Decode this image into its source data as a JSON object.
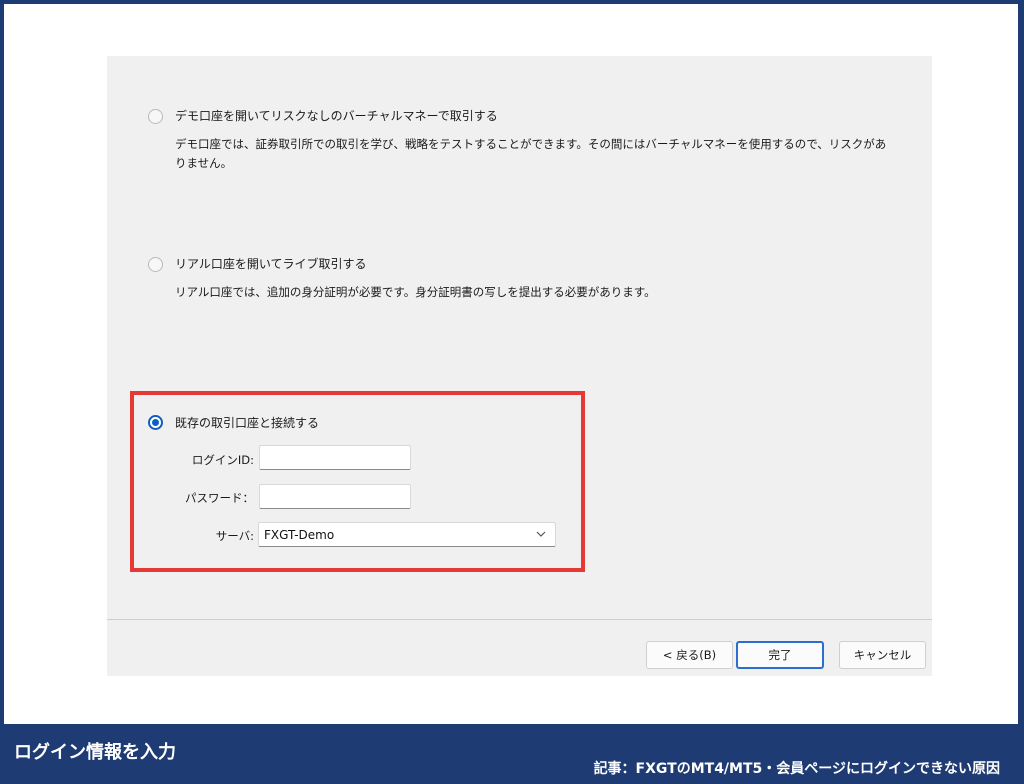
{
  "dialog": {
    "options": [
      {
        "title": "デモ口座を開いてリスクなしのバーチャルマネーで取引する",
        "description": "デモ口座では、証券取引所での取引を学び、戦略をテストすることができます。その間にはバーチャルマネーを使用するので、リスクがありません。",
        "selected": false
      },
      {
        "title": "リアル口座を開いてライブ取引する",
        "description": "リアル口座では、追加の身分証明が必要です。身分証明書の写しを提出する必要があります。",
        "selected": false
      },
      {
        "title": "既存の取引口座と接続する",
        "selected": true
      }
    ],
    "login": {
      "login_id_label": "ログインID:",
      "login_id_value": "",
      "password_label": "パスワード：",
      "password_value": "",
      "server_label": "サーバ:",
      "server_value": "FXGT-Demo"
    },
    "buttons": {
      "back": "< 戻る(B)",
      "finish": "完了",
      "cancel": "キャンセル"
    }
  },
  "captions": {
    "left": "ログイン情報を入力",
    "right": "記事：FXGTのMT4/MT5・会員ページにログインできない原因"
  },
  "colors": {
    "highlight_border": "#e53935",
    "radio_selected": "#0a5ec4",
    "background_band": "#1f3b73"
  }
}
